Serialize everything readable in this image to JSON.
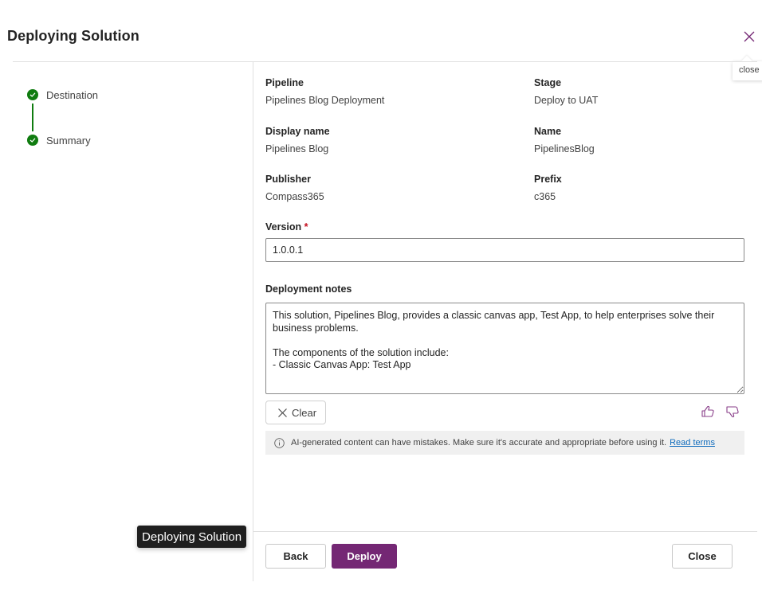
{
  "dialog": {
    "title": "Deploying Solution",
    "close_tooltip": "close"
  },
  "steps": [
    {
      "label": "Destination",
      "status": "complete"
    },
    {
      "label": "Summary",
      "status": "complete"
    }
  ],
  "details": {
    "pipeline": {
      "label": "Pipeline",
      "value": "Pipelines Blog Deployment"
    },
    "stage": {
      "label": "Stage",
      "value": "Deploy to UAT"
    },
    "display_name": {
      "label": "Display name",
      "value": "Pipelines Blog"
    },
    "name": {
      "label": "Name",
      "value": "PipelinesBlog"
    },
    "publisher": {
      "label": "Publisher",
      "value": "Compass365"
    },
    "prefix": {
      "label": "Prefix",
      "value": "c365"
    }
  },
  "version": {
    "label": "Version",
    "required_mark": "*",
    "value": "1.0.0.1"
  },
  "notes": {
    "label": "Deployment notes",
    "value": "This solution, Pipelines Blog, provides a classic canvas app, Test App, to help enterprises solve their business problems.\n\nThe components of the solution include:\n- Classic Canvas App: Test App"
  },
  "actions": {
    "clear_label": "Clear",
    "back_label": "Back",
    "deploy_label": "Deploy",
    "close_label": "Close"
  },
  "ai_banner": {
    "text": "AI-generated content can have mistakes. Make sure it's accurate and appropriate before using it.",
    "link_text": "Read terms"
  },
  "hover_tooltip": "Deploying Solution",
  "colors": {
    "accent": "#742774",
    "success": "#107c10",
    "link": "#0f6cbd",
    "required": "#c50f1f"
  },
  "icons": {
    "close": "close-icon",
    "step_check": "checkmark-circle-icon",
    "clear": "dismiss-icon",
    "thumb_up": "thumb-up-icon",
    "thumb_down": "thumb-down-icon",
    "info": "info-icon"
  }
}
